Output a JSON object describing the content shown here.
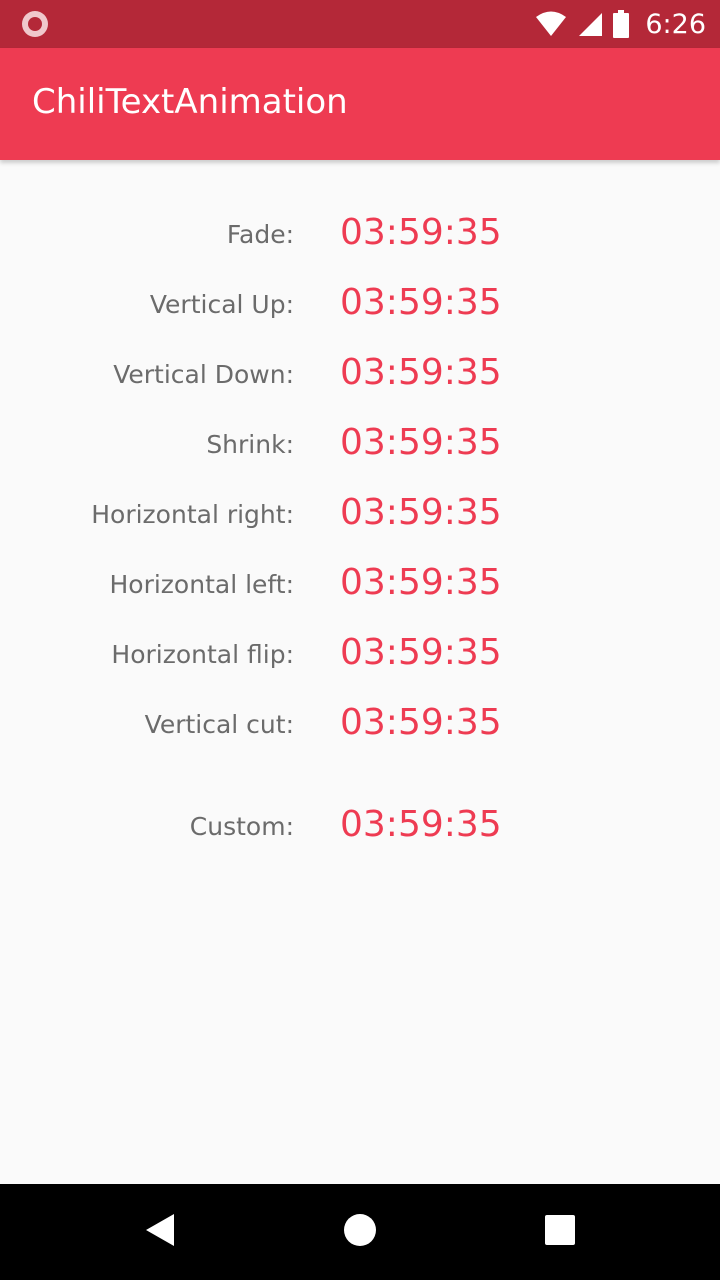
{
  "status_bar": {
    "time": "6:26",
    "icons": [
      "notification-icon",
      "wifi-icon",
      "signal-icon",
      "battery-icon"
    ],
    "background": "#b42838"
  },
  "app_bar": {
    "title": "ChiliTextAnimation",
    "background": "#ee3b52"
  },
  "rows": [
    {
      "label": "Fade:",
      "value": "03:59:35"
    },
    {
      "label": "Vertical Up:",
      "value": "03:59:35"
    },
    {
      "label": "Vertical Down:",
      "value": "03:59:35"
    },
    {
      "label": "Shrink:",
      "value": "03:59:35"
    },
    {
      "label": "Horizontal right:",
      "value": "03:59:35"
    },
    {
      "label": "Horizontal left:",
      "value": "03:59:35"
    },
    {
      "label": "Horizontal flip:",
      "value": "03:59:35"
    },
    {
      "label": "Vertical cut:",
      "value": "03:59:35"
    },
    {
      "label": "Custom:",
      "value": "03:59:35"
    }
  ],
  "colors": {
    "accent": "#ee3b52",
    "label_text": "#6b6b6b",
    "background": "#fafafa"
  },
  "nav_bar": {
    "icons": [
      "back-icon",
      "home-icon",
      "recent-apps-icon"
    ]
  }
}
